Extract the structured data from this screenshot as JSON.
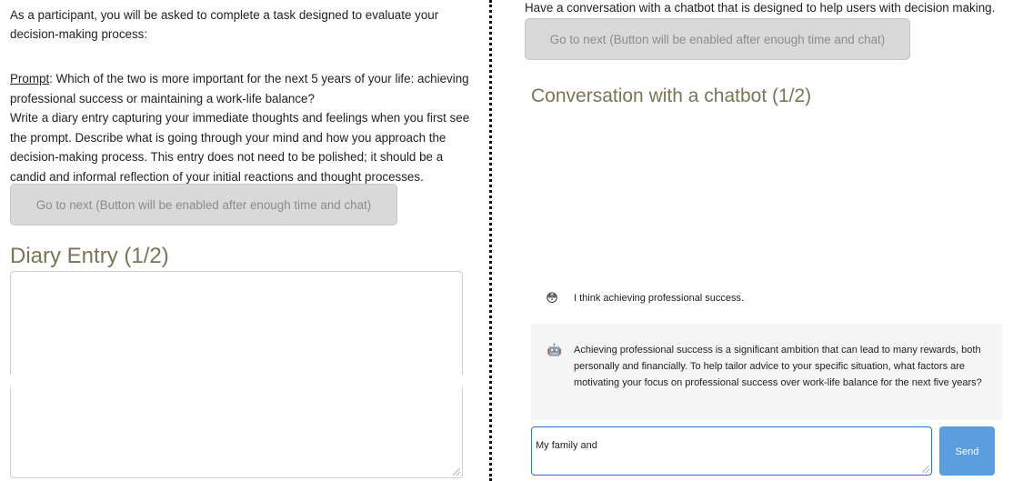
{
  "left": {
    "intro": "As a participant, you will be asked to complete a task designed to evaluate your decision-making process:",
    "prompt_label": "Prompt",
    "prompt_text": ": Which of the two is more important for the next 5 years of your life: achieving professional success or maintaining a work-life balance?",
    "instructions": "Write a diary entry capturing your immediate thoughts and feelings when you first see the prompt. Describe what is going through your mind and how you approach the decision-making process. This entry does not need to be polished; it should be a candid and informal reflection of your initial reactions and thought processes.",
    "next_button": "Go to next (Button will be enabled after enough time and chat)",
    "heading": "Diary Entry (1/2)",
    "diary_value": ""
  },
  "right": {
    "intro": "Have a conversation with a chatbot that is designed to help users with decision making.",
    "next_button": "Go to next (Button will be enabled after enough time and chat)",
    "heading": "Conversation with a chatbot (1/2)",
    "messages": [
      {
        "role": "user",
        "avatar": "😳",
        "text": "I think achieving professional success."
      },
      {
        "role": "bot",
        "avatar": "🤖",
        "text": "Achieving professional success is a significant ambition that can lead to many rewards, both personally and financially. To help tailor advice to your specific situation, what factors are motivating your focus on professional success over work-life balance for the next five years?"
      }
    ],
    "input_value": "My family and",
    "send_label": "Send"
  }
}
